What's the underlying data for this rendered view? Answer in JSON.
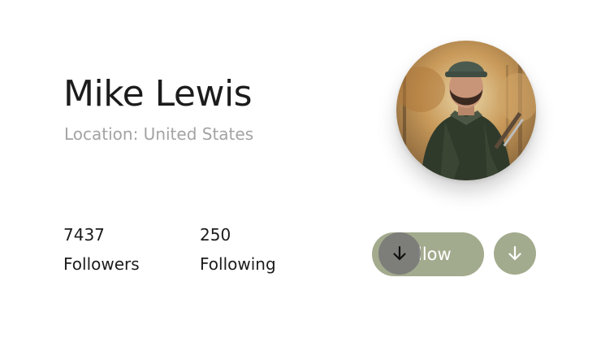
{
  "profile": {
    "name": "Mike Lewis",
    "location": "Location: United States",
    "avatar_icon": "user-photo"
  },
  "stats": [
    {
      "value": "7437",
      "label": "Followers"
    },
    {
      "value": "250",
      "label": "Following"
    }
  ],
  "actions": {
    "follow_label": "Follow",
    "follow_visible_label": "llow",
    "follow_icon": "arrow-down-icon",
    "secondary_icon": "arrow-down-icon"
  },
  "colors": {
    "accent": "#a3ab8e",
    "name_text": "#1c1c1c",
    "muted_text": "#a3a3a3",
    "knob": "#7a7a7a"
  }
}
